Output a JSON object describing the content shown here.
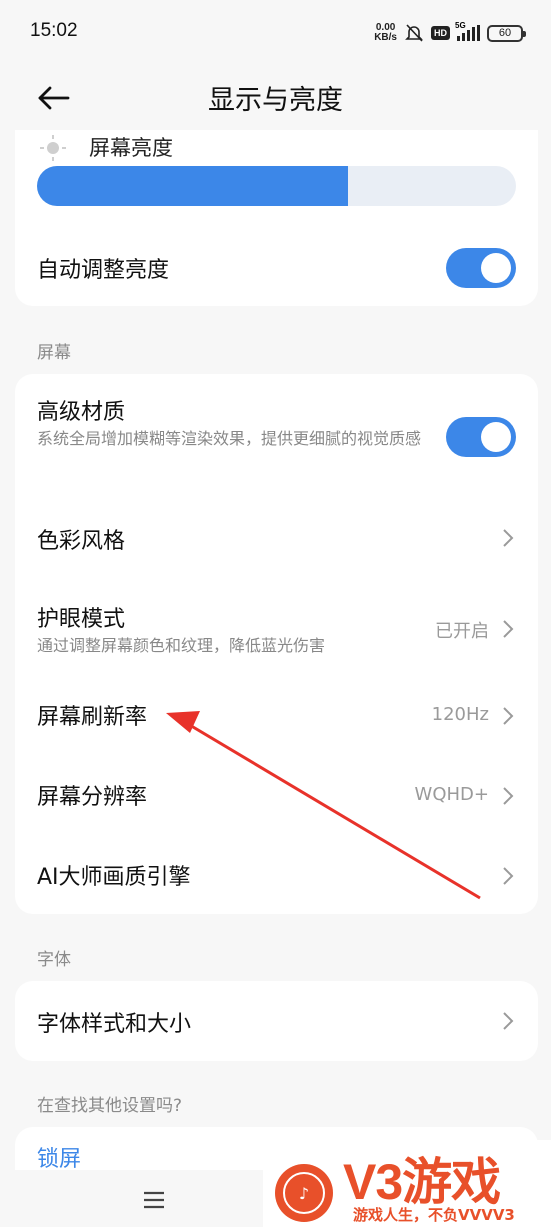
{
  "status_bar": {
    "time": "15:02",
    "net_speed_value": "0.00",
    "net_speed_unit": "KB/s",
    "hd_badge": "HD",
    "network": "5G",
    "battery": "60"
  },
  "header": {
    "title": "显示与亮度"
  },
  "brightness": {
    "label": "屏幕亮度",
    "level_fraction": 0.65,
    "auto_label": "自动调整亮度",
    "auto_enabled": true
  },
  "screen_section": {
    "label": "屏幕",
    "items": [
      {
        "title": "高级材质",
        "subtitle": "系统全局增加模糊等渲染效果，提供更细腻的视觉质感",
        "toggle": true
      },
      {
        "title": "色彩风格"
      },
      {
        "title": "护眼模式",
        "subtitle": "通过调整屏幕颜色和纹理，降低蓝光伤害",
        "value": "已开启"
      },
      {
        "title": "屏幕刷新率",
        "value": "120Hz"
      },
      {
        "title": "屏幕分辨率",
        "value": "WQHD+"
      },
      {
        "title": "AI大师画质引擎"
      }
    ]
  },
  "font_section": {
    "label": "字体",
    "item": "字体样式和大小"
  },
  "search_section": {
    "label": "在查找其他设置吗?",
    "item": "锁屏"
  },
  "watermark": {
    "brand": "V3游戏",
    "slogan": "游戏人生，不负VVVV3"
  },
  "colors": {
    "accent": "#3c87e8",
    "annotation_arrow": "#e8322a",
    "background": "#f7f7f7"
  },
  "icons": [
    "back-arrow-icon",
    "sun-icon",
    "chevron-right-icon",
    "menu-icon",
    "mute-bell-icon",
    "signal-icon",
    "battery-icon"
  ]
}
